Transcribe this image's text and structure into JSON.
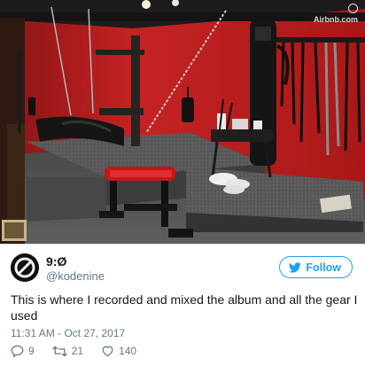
{
  "photo": {
    "watermark": "Airbnb.com",
    "description_icon": "airbnb-logo-icon"
  },
  "tweet": {
    "display_name": "9:Ø",
    "handle": "@kodenine",
    "follow_label": "Follow",
    "text": "This is where I recorded and mixed the album and all the gear I used",
    "timestamp": "11:31 AM - Oct 27, 2017",
    "actions": {
      "reply_count": "9",
      "retweet_count": "21",
      "like_count": "140"
    }
  },
  "colors": {
    "accent": "#1da1f2",
    "secondary_text": "#657786",
    "primary_text": "#14171a"
  },
  "icons": [
    "airbnb-logo-icon",
    "avatar-logo",
    "twitter-bird-icon",
    "reply-icon",
    "retweet-icon",
    "like-icon"
  ]
}
